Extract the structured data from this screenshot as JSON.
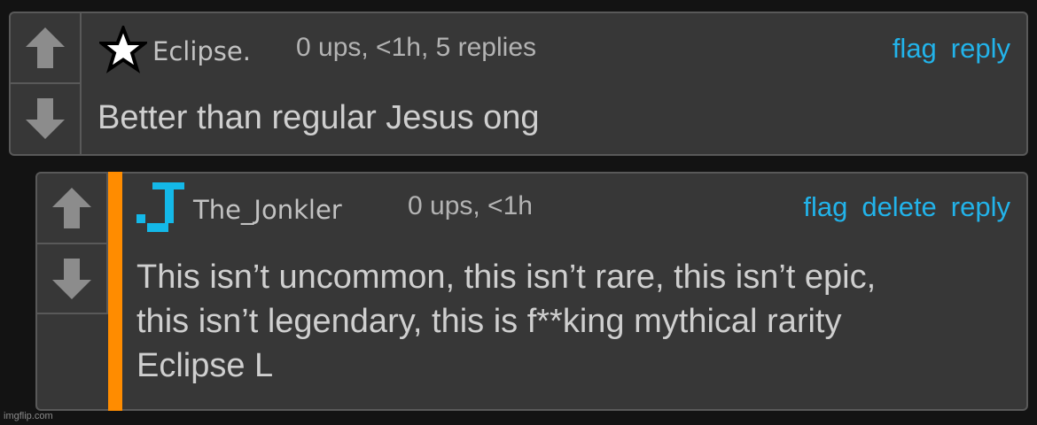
{
  "comments": [
    {
      "username": "Eclipse.",
      "meta": "0 ups, <1h, 5 replies",
      "actions": [
        "flag",
        "reply"
      ],
      "text": "Better than regular Jesus ong",
      "avatar_icon": "star-icon"
    },
    {
      "username": "The_Jonkler",
      "meta": "0 ups, <1h",
      "actions": [
        "flag",
        "delete",
        "reply"
      ],
      "text": "This isn’t uncommon, this isn’t rare, this isn’t epic,\nthis isn’t legendary, this is f**king mythical rarity\nEclipse L",
      "avatar_icon": "j-letter-icon",
      "accent_color": "#ff8c00"
    }
  ],
  "watermark": "imgflip.com",
  "colors": {
    "background": "#131313",
    "panel": "#373737",
    "border": "#595959",
    "link": "#22b3ea",
    "arrow": "#8c8c8c"
  }
}
